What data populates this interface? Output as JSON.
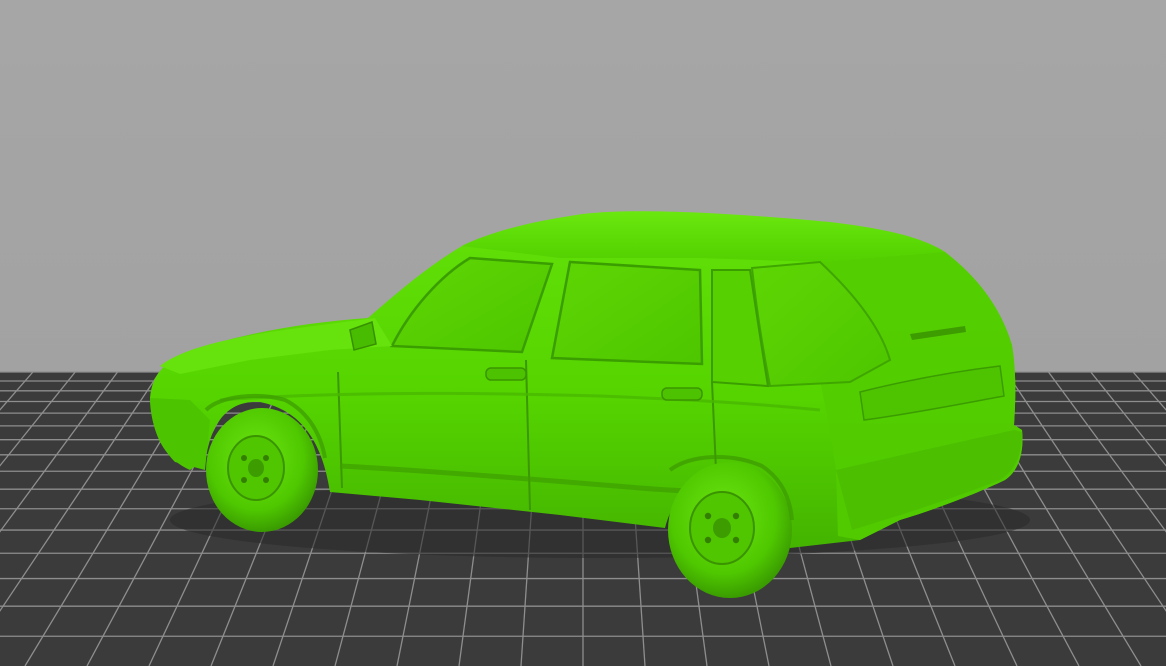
{
  "viewport": {
    "background_color": "#a2a2a2",
    "build_plate": {
      "fill_color": "#3a3a3a",
      "grid_color": "#8c8c8c"
    },
    "model": {
      "body_color": "#58d800",
      "shade_color": "#3fa800",
      "highlight_color": "#7cf01e"
    }
  }
}
